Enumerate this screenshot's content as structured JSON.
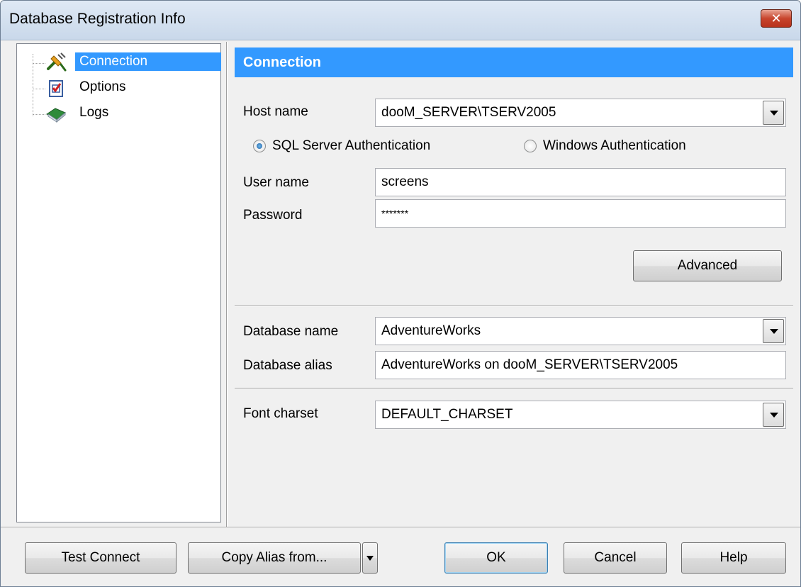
{
  "window": {
    "title": "Database Registration Info",
    "close_glyph": "✕"
  },
  "tree": {
    "items": [
      {
        "label": "Connection",
        "icon": "plug-icon",
        "selected": true
      },
      {
        "label": "Options",
        "icon": "checklist-icon",
        "selected": false
      },
      {
        "label": "Logs",
        "icon": "book-icon",
        "selected": false
      }
    ]
  },
  "connection": {
    "header": "Connection",
    "host_name_label": "Host name",
    "host_name_value": "dooM_SERVER\\TSERV2005",
    "auth_sql_label": "SQL Server Authentication",
    "auth_windows_label": "Windows Authentication",
    "auth_selected": "sql",
    "user_name_label": "User name",
    "user_name_value": "screens",
    "password_label": "Password",
    "password_value": "*******",
    "advanced_button": "Advanced",
    "database_name_label": "Database name",
    "database_name_value": "AdventureWorks",
    "database_alias_label": "Database alias",
    "database_alias_value": "AdventureWorks on dooM_SERVER\\TSERV2005",
    "font_charset_label": "Font charset",
    "font_charset_value": "DEFAULT_CHARSET"
  },
  "footer": {
    "test_connect": "Test Connect",
    "copy_alias": "Copy Alias from...",
    "ok": "OK",
    "cancel": "Cancel",
    "help": "Help"
  },
  "colors": {
    "accent": "#3399ff",
    "dialog_bg": "#f0f0f0",
    "close_red": "#c8452d"
  }
}
